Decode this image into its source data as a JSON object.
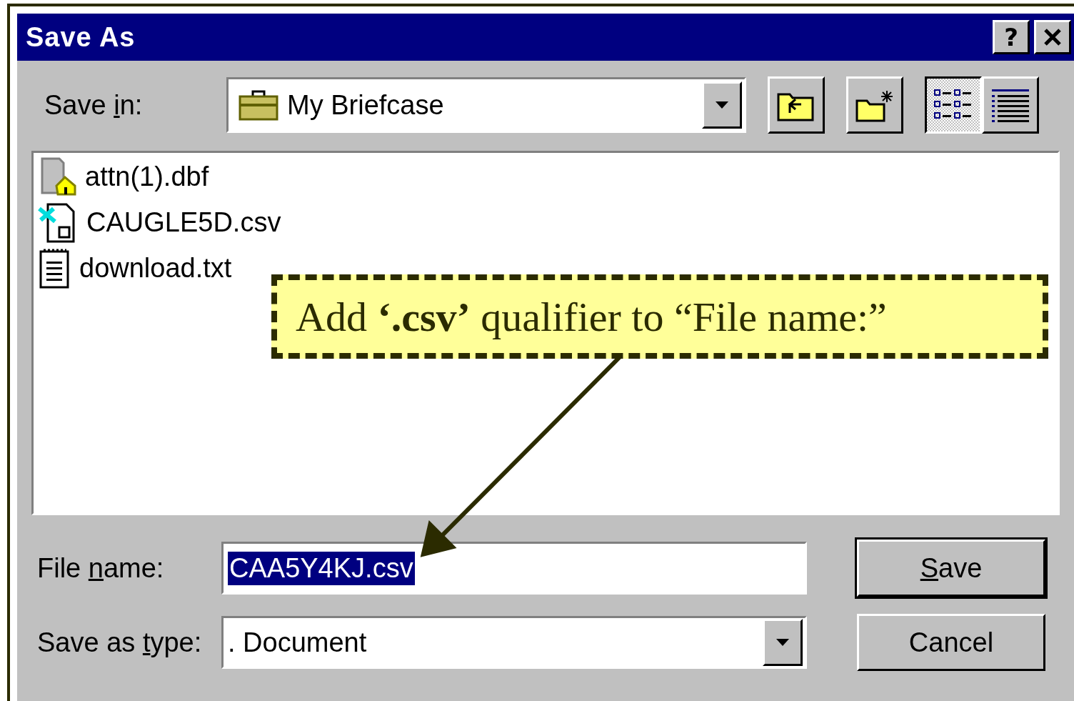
{
  "window": {
    "title": "Save As",
    "title_buttons": [
      {
        "kind": "help",
        "label": "?"
      },
      {
        "kind": "close"
      }
    ]
  },
  "save_in": {
    "label": {
      "before": "Save ",
      "mnemonic": "i",
      "after": "n:"
    },
    "value": "My Briefcase"
  },
  "toolbar": [
    {
      "kind": "up-folder",
      "selected": false
    },
    {
      "kind": "new-folder",
      "selected": false
    },
    {
      "kind": "list",
      "selected": true
    },
    {
      "kind": "details",
      "selected": false
    }
  ],
  "files": [
    {
      "name": "attn(1).dbf",
      "kind": "dbf"
    },
    {
      "name": "CAUGLE5D.csv",
      "kind": "csv"
    },
    {
      "name": "download.txt",
      "kind": "txt"
    }
  ],
  "file_name": {
    "label": {
      "before": "File ",
      "mnemonic": "n",
      "after": "ame:"
    },
    "value": "CAA5Y4KJ.csv",
    "selected": true
  },
  "save_as_type": {
    "label": {
      "before": "Save as ",
      "mnemonic": "t",
      "after": "ype:"
    },
    "value": ". Document"
  },
  "buttons": [
    {
      "label": {
        "mnemonic": "S",
        "after": "ave"
      },
      "default": true
    },
    {
      "label": {
        "before": "Cancel"
      },
      "default": false
    }
  ],
  "callout": {
    "text": "Add **‘.csv’** qualifier to “File name:”"
  }
}
